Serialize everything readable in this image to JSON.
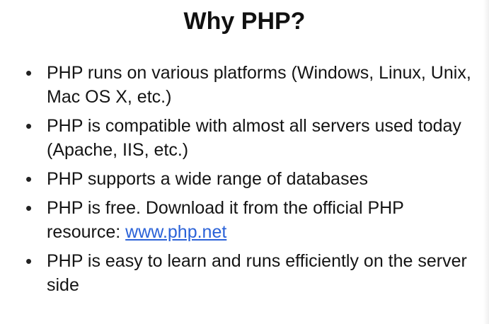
{
  "slide": {
    "title": "Why PHP?",
    "bullets": [
      {
        "text": "PHP runs on various platforms (Windows, Linux, Unix, Mac OS X, etc.)"
      },
      {
        "text": "PHP is compatible with almost all servers used today (Apache, IIS, etc.)"
      },
      {
        "text": "PHP supports a wide range of databases"
      },
      {
        "text_before_link": "PHP is free. Download it from the official PHP resource: ",
        "link_text": "www.php.net"
      },
      {
        "text": "PHP is easy to learn and runs efficiently on the server side"
      }
    ]
  }
}
